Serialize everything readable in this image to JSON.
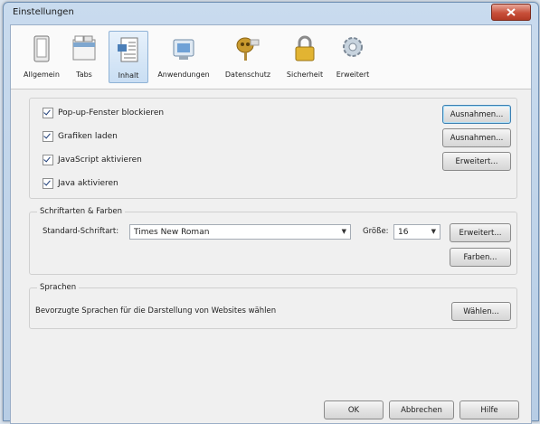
{
  "window": {
    "title": "Einstellungen"
  },
  "toolbar": {
    "tabs": [
      {
        "label": "Allgemein",
        "icon": "switch-icon"
      },
      {
        "label": "Tabs",
        "icon": "tabs-window-icon"
      },
      {
        "label": "Inhalt",
        "icon": "content-page-icon",
        "active": true
      },
      {
        "label": "Anwendungen",
        "icon": "applications-icon"
      },
      {
        "label": "Datenschutz",
        "icon": "mask-icon"
      },
      {
        "label": "Sicherheit",
        "icon": "lock-icon"
      },
      {
        "label": "Erweitert",
        "icon": "gear-icon"
      }
    ]
  },
  "content": {
    "checkboxes": [
      {
        "label": "Pop-up-Fenster blockieren",
        "checked": true
      },
      {
        "label": "Grafiken laden",
        "checked": true
      },
      {
        "label": "JavaScript aktivieren",
        "checked": true
      },
      {
        "label": "Java aktivieren",
        "checked": true
      }
    ],
    "buttons": {
      "exceptions1": "Ausnahmen...",
      "exceptions2": "Ausnahmen...",
      "advanced_js": "Erweitert..."
    }
  },
  "fonts": {
    "group_title": "Schriftarten & Farben",
    "default_font_label": "Standard-Schriftart:",
    "default_font_value": "Times New Roman",
    "size_label": "Größe:",
    "size_value": "16",
    "advanced_button": "Erweitert...",
    "colors_button": "Farben..."
  },
  "languages": {
    "group_title": "Sprachen",
    "description": "Bevorzugte Sprachen für die Darstellung von Websites wählen",
    "choose_button": "Wählen..."
  },
  "footer": {
    "ok": "OK",
    "cancel": "Abbrechen",
    "help": "Hilfe"
  },
  "colors": {
    "window_border": "#6f8fb3",
    "close_button": "#c8503a",
    "active_tab": "#c9def3"
  }
}
